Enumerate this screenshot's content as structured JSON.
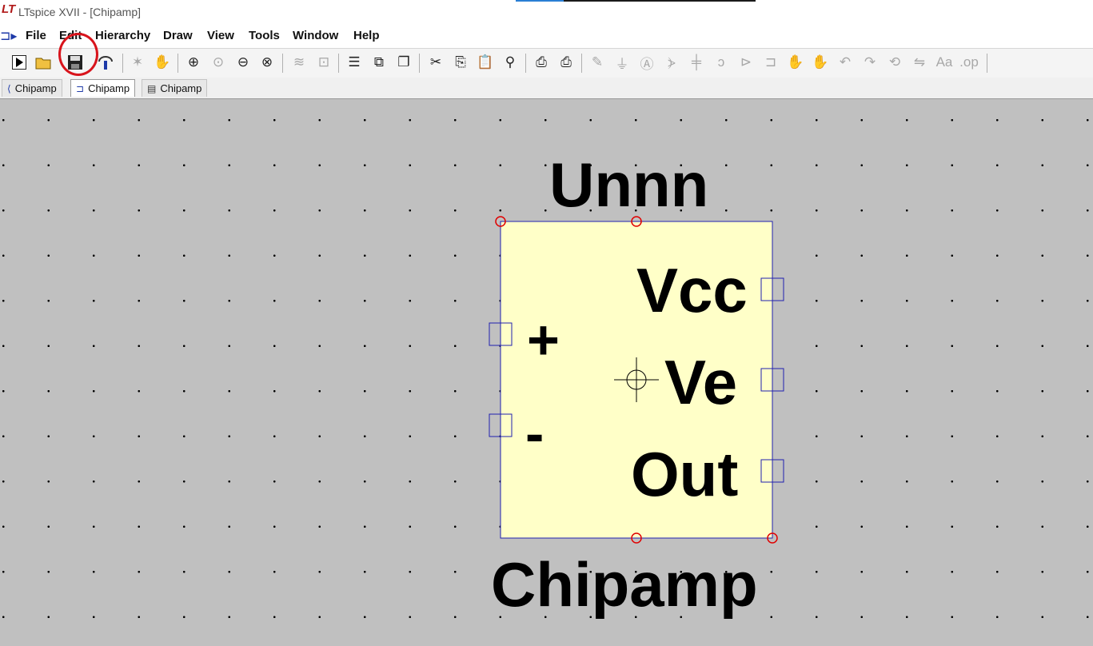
{
  "window": {
    "title": "LTspice XVII - [Chipamp]",
    "logo": "LT"
  },
  "menu": {
    "items": [
      {
        "label": "File"
      },
      {
        "label": "Edit"
      },
      {
        "label": "Hierarchy"
      },
      {
        "label": "Draw"
      },
      {
        "label": "View"
      },
      {
        "label": "Tools"
      },
      {
        "label": "Window"
      },
      {
        "label": "Help"
      }
    ]
  },
  "toolbar": {
    "highlighted_button": "save-icon",
    "highlight_color": "#d8141c"
  },
  "tabs": [
    {
      "label": "Chipamp",
      "icon": "schematic-icon"
    },
    {
      "label": "Chipamp",
      "icon": "symbol-icon",
      "active": true
    },
    {
      "label": "Chipamp",
      "icon": "netlist-icon"
    }
  ],
  "symbol": {
    "inst_name": "Unnn",
    "value": "Chipamp",
    "pins": {
      "plus": "+",
      "minus": "-",
      "vcc": "Vcc",
      "ve": "Ve",
      "out": "Out"
    },
    "body_fill": "#ffffc8",
    "outline_color": "#2020b0",
    "grid_background": "#c0c0c0"
  }
}
